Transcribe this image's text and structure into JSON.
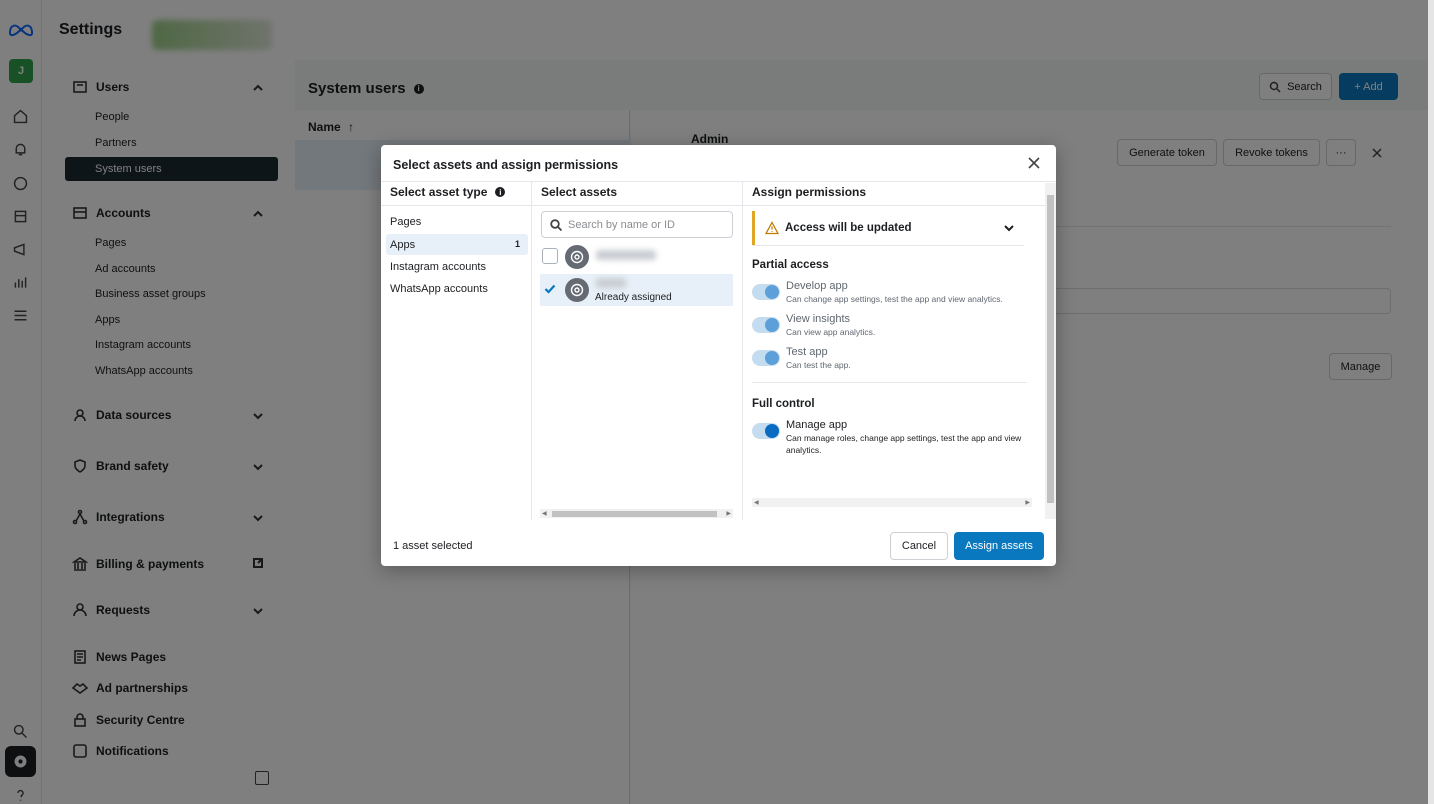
{
  "app": {
    "title": "Settings"
  },
  "sidebar": {
    "sections": [
      {
        "label": "Users",
        "items": [
          "People",
          "Partners",
          "System users"
        ],
        "active_item": "System users"
      },
      {
        "label": "Accounts",
        "items": [
          "Pages",
          "Ad accounts",
          "Business asset groups",
          "Apps",
          "Instagram accounts",
          "WhatsApp accounts"
        ]
      },
      {
        "label": "Data sources"
      },
      {
        "label": "Brand safety"
      },
      {
        "label": "Integrations"
      },
      {
        "label": "Billing & payments"
      },
      {
        "label": "Requests"
      },
      {
        "label": "News Pages"
      },
      {
        "label": "Ad partnerships"
      },
      {
        "label": "Security Centre"
      },
      {
        "label": "Notifications"
      }
    ]
  },
  "main": {
    "title": "System users",
    "search_label": "Search",
    "add_label": "+ Add",
    "column_name": "Name",
    "sort_arrow": "↑",
    "detail": {
      "name": "Admin",
      "generate_token_label": "Generate token",
      "revoke_tokens_label": "Revoke tokens",
      "more_label": "···",
      "manage_label": "Manage"
    }
  },
  "modal": {
    "title": "Select assets and assign permissions",
    "col_asset_type": "Select asset type",
    "col_select_assets": "Select assets",
    "col_assign_permissions": "Assign permissions",
    "asset_types": [
      {
        "label": "Pages",
        "count": ""
      },
      {
        "label": "Apps",
        "count": "1",
        "selected": true
      },
      {
        "label": "Instagram accounts",
        "count": ""
      },
      {
        "label": "WhatsApp accounts",
        "count": ""
      }
    ],
    "search_placeholder": "Search by name or ID",
    "assets": [
      {
        "checked": false,
        "status": ""
      },
      {
        "checked": true,
        "status": "Already assigned"
      }
    ],
    "alert": "Access will be updated",
    "partial_access_label": "Partial access",
    "full_control_label": "Full control",
    "permissions": [
      {
        "title": "Develop app",
        "desc": "Can change app settings, test the app and view analytics."
      },
      {
        "title": "View insights",
        "desc": "Can view app analytics."
      },
      {
        "title": "Test app",
        "desc": "Can test the app."
      },
      {
        "title": "Manage app",
        "desc": "Can manage roles, change app settings, test the app and view analytics."
      }
    ],
    "selected_count": "1 asset selected",
    "cancel_label": "Cancel",
    "assign_label": "Assign assets"
  },
  "colors": {
    "primary": "#0a78be",
    "warning": "#e0a526",
    "active_nav": "#1c2b33"
  }
}
